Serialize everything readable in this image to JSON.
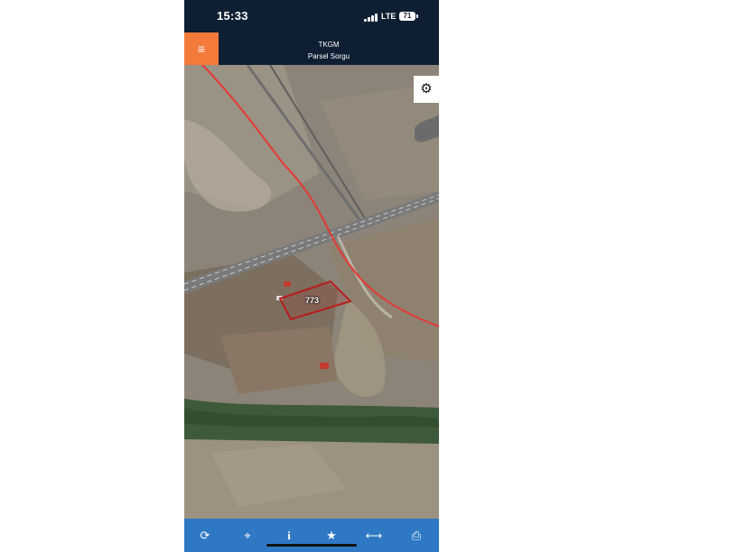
{
  "status_bar": {
    "time": "15:33",
    "network": "LTE",
    "battery": "71"
  },
  "app_header": {
    "menu_icon": "≡",
    "title": "TKGM",
    "subtitle": "Parsel Sorgu"
  },
  "map": {
    "parcel_number": "773",
    "settings_icon": "gear-icon",
    "boundary_color": "#e53935",
    "parcel_color": "#b71c1c"
  },
  "toolbar": {
    "items": [
      {
        "name": "refresh",
        "icon": "⟳"
      },
      {
        "name": "locate",
        "icon": "⌖"
      },
      {
        "name": "info",
        "icon": "i"
      },
      {
        "name": "favorite",
        "icon": "★"
      },
      {
        "name": "measure",
        "icon": "⟷"
      },
      {
        "name": "print",
        "icon": "⎙"
      }
    ]
  }
}
